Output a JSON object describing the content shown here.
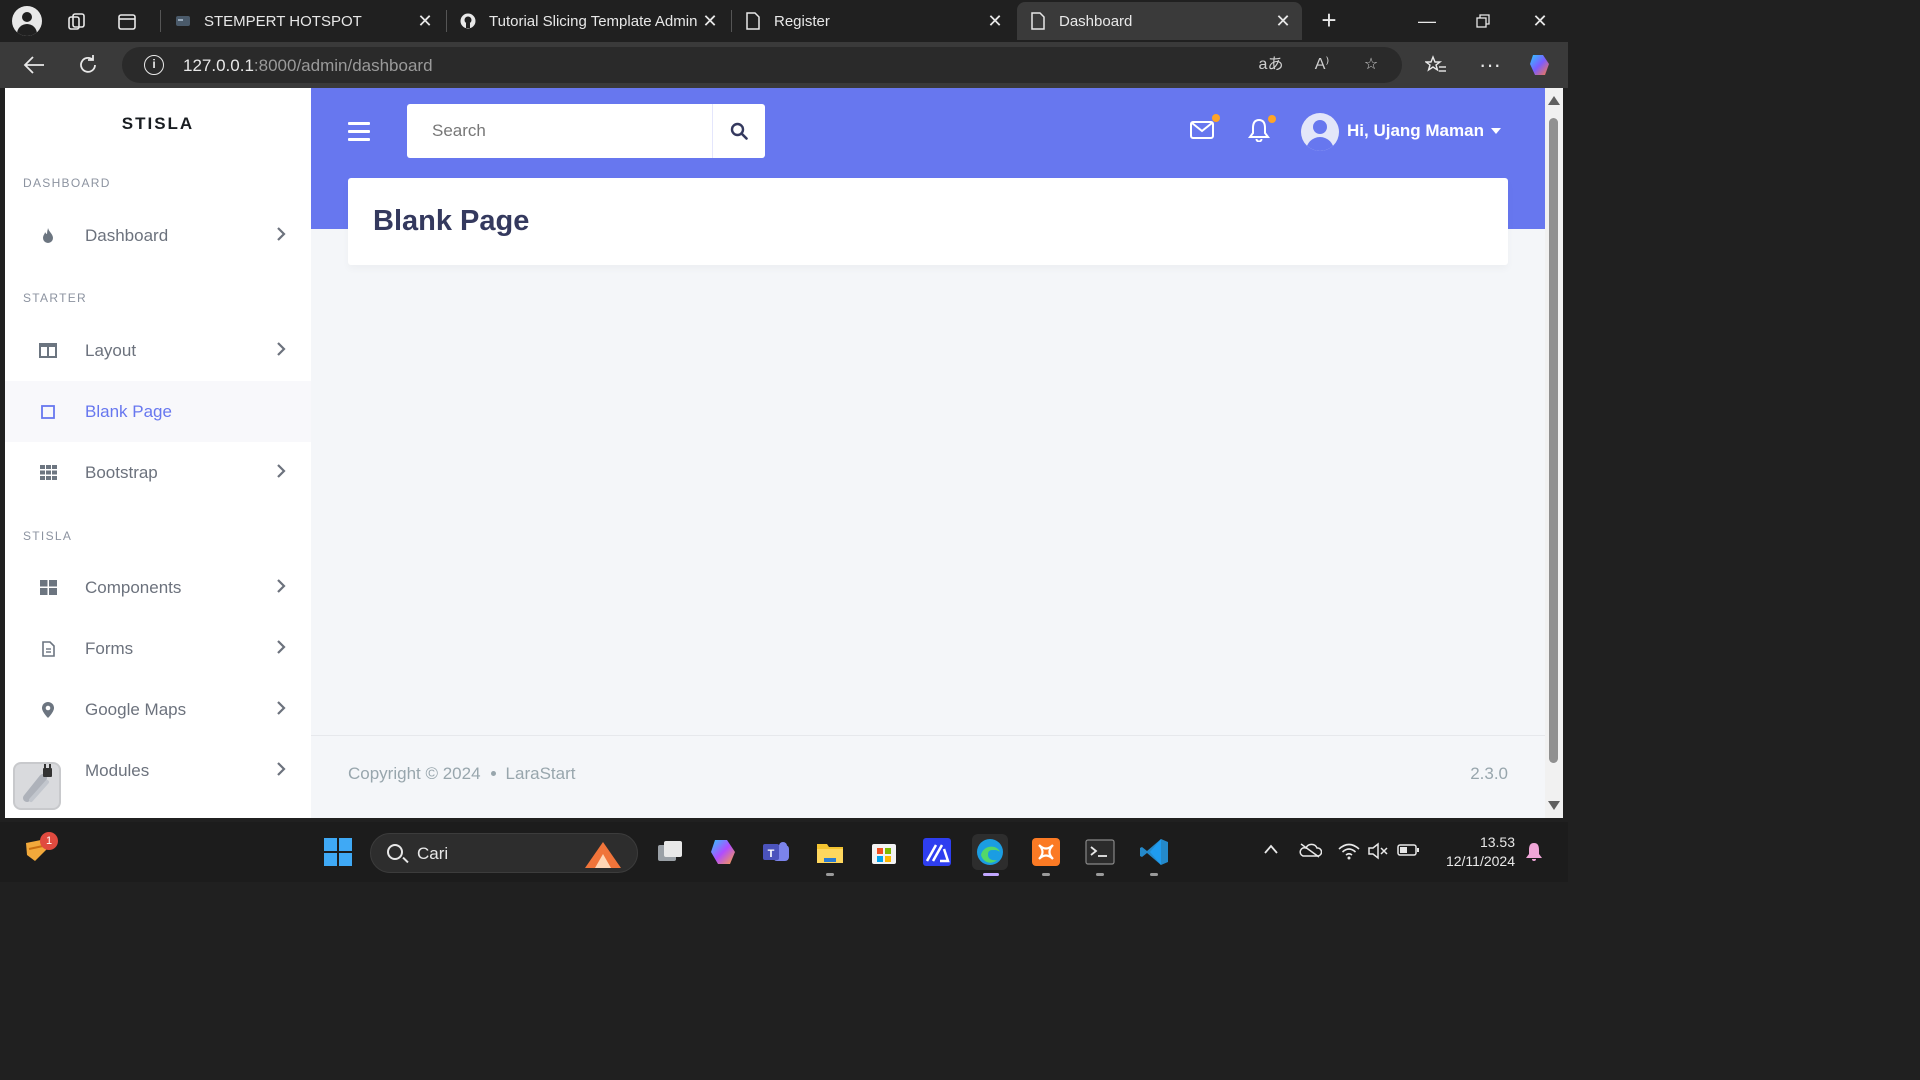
{
  "browser": {
    "tabs": [
      {
        "title": "STEMPERT HOTSPOT",
        "active": false
      },
      {
        "title": "Tutorial Slicing Template Admin",
        "active": false
      },
      {
        "title": "Register",
        "active": false
      },
      {
        "title": "Dashboard",
        "active": true
      }
    ],
    "url_host": "127.0.0.1",
    "url_path": ":8000/admin/dashboard"
  },
  "app": {
    "brand": "STISLA",
    "accent_color": "#6777ef",
    "search_placeholder": "Search",
    "user_greeting": "Hi, Ujang Maman",
    "sidebar": {
      "sections": [
        {
          "header": "DASHBOARD",
          "items": [
            {
              "label": "Dashboard",
              "icon": "fire-icon"
            }
          ]
        },
        {
          "header": "STARTER",
          "items": [
            {
              "label": "Layout",
              "icon": "columns-icon"
            },
            {
              "label": "Blank Page",
              "icon": "square-icon",
              "active": true
            },
            {
              "label": "Bootstrap",
              "icon": "grid-icon"
            }
          ]
        },
        {
          "header": "STISLA",
          "items": [
            {
              "label": "Components",
              "icon": "th-large-icon"
            },
            {
              "label": "Forms",
              "icon": "file-icon"
            },
            {
              "label": "Google Maps",
              "icon": "map-marker-icon"
            },
            {
              "label": "Modules",
              "icon": "plug-icon"
            }
          ]
        }
      ]
    },
    "page_title": "Blank Page",
    "footer": {
      "copyright": "Copyright © 2024",
      "brand": "LaraStart",
      "version": "2.3.0"
    }
  },
  "taskbar": {
    "search_label": "Cari",
    "notification_count": "1",
    "time": "13.53",
    "date": "12/11/2024"
  }
}
